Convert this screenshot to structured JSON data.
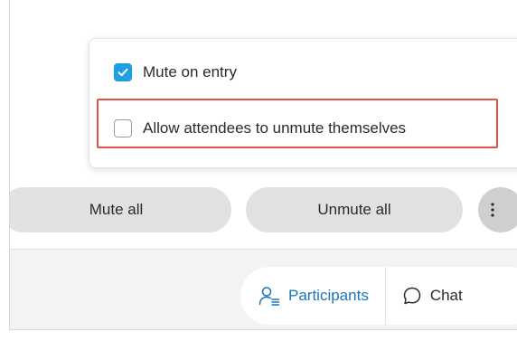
{
  "audio_options": {
    "mute_on_entry": {
      "label": "Mute on entry",
      "checked": true
    },
    "allow_unmute": {
      "label": "Allow attendees to unmute themselves",
      "checked": false
    }
  },
  "actions": {
    "mute_all_label": "Mute all",
    "unmute_all_label": "Unmute all",
    "more_icon": "more-vertical-icon"
  },
  "tabs": [
    {
      "label": "Participants",
      "icon": "participants-icon",
      "active": true
    },
    {
      "label": "Chat",
      "icon": "chat-icon",
      "active": false
    }
  ],
  "colors": {
    "accent": "#1f9fe0",
    "active_tab_text": "#1976b8",
    "highlight_border": "#e0524a",
    "pill_background": "#e1e1e1"
  }
}
